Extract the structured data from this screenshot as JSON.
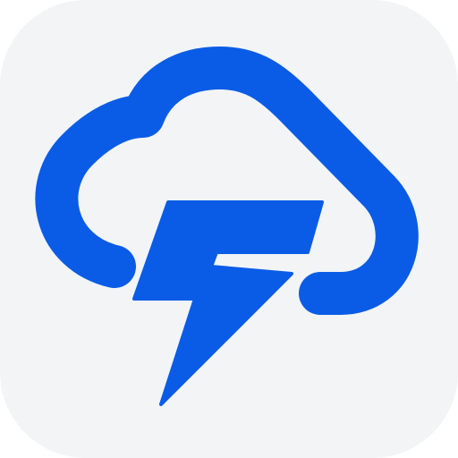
{
  "app_icon": {
    "icon": "cloud-lightning-icon",
    "tile_color": "#F2F4F6",
    "accent_color": "#0A5CE6"
  }
}
